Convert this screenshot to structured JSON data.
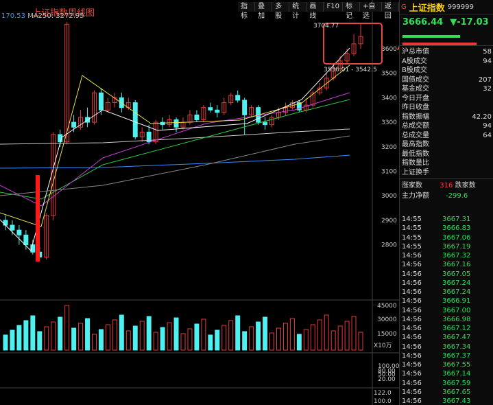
{
  "window": {
    "chart_title": "上证指数周线图"
  },
  "toolbar": {
    "buttons": [
      "指标",
      "叠加",
      "多股",
      "统计",
      "画线",
      "F10",
      "标记",
      "+自选",
      "返回"
    ]
  },
  "ma_legend": {
    "left_value": "170.53",
    "ma250_label": "MA250: 3272.95"
  },
  "chart_data": {
    "type": "candlestick",
    "price_axis_ticks": [
      "3600",
      "3500",
      "3400",
      "3300",
      "3200",
      "3100",
      "3000",
      "2900",
      "2800"
    ],
    "volume_axis_ticks": [
      "45000",
      "30000",
      "15000"
    ],
    "volume_unit": "X10万",
    "indicator_axis_ticks": [
      "100.00",
      "80.00",
      "50.00",
      "20.00"
    ],
    "bottom_axis_ticks": [
      "122.0",
      "100.0"
    ],
    "annotations": {
      "high_label": "3704.77",
      "range_label": "3536.01 - 3542.5"
    }
  },
  "quote": {
    "prefix": "G",
    "name": "上证指数",
    "code": "999999",
    "price": "3666.44",
    "change": "▼-17.03"
  },
  "info_rows": [
    {
      "label": "沪总市值",
      "value": "58"
    },
    {
      "label": "A股成交",
      "value": "94"
    },
    {
      "label": "B股成交",
      "value": ""
    },
    {
      "label": "国债成交",
      "value": "207"
    },
    {
      "label": "基金成交",
      "value": "32"
    },
    {
      "label": "今日开盘",
      "value": ""
    },
    {
      "label": "昨日收盘",
      "value": ""
    },
    {
      "label": "指数振幅",
      "value": "42.20"
    },
    {
      "label": "总成交额",
      "value": "94"
    },
    {
      "label": "总成交量",
      "value": "64"
    },
    {
      "label": "最高指数",
      "value": ""
    },
    {
      "label": "最低指数",
      "value": ""
    },
    {
      "label": "指数量比",
      "value": ""
    },
    {
      "label": "上证换手",
      "value": ""
    }
  ],
  "updown": {
    "up_label": "涨家数",
    "up_value": "316",
    "down_label": "跌家数"
  },
  "main_flow": {
    "label": "主力净额",
    "value": "-299.6"
  },
  "ticks": [
    {
      "time": "14:55",
      "price": "3667.31"
    },
    {
      "time": "14:55",
      "price": "3666.83"
    },
    {
      "time": "14:55",
      "price": "3667.06"
    },
    {
      "time": "14:55",
      "price": "3667.19"
    },
    {
      "time": "14:56",
      "price": "3667.32"
    },
    {
      "time": "14:56",
      "price": "3667.16"
    },
    {
      "time": "14:56",
      "price": "3667.05"
    },
    {
      "time": "14:56",
      "price": "3667.24"
    },
    {
      "time": "14:56",
      "price": "3667.24"
    },
    {
      "time": "14:56",
      "price": "3666.91"
    },
    {
      "time": "14:56",
      "price": "3667.00"
    },
    {
      "time": "14:56",
      "price": "3666.98"
    },
    {
      "time": "14:56",
      "price": "3667.12"
    },
    {
      "time": "14:56",
      "price": "3667.47"
    },
    {
      "time": "14:56",
      "price": "3667.34"
    },
    {
      "time": "14:56",
      "price": "3667.37"
    },
    {
      "time": "14:56",
      "price": "3667.55"
    },
    {
      "time": "14:56",
      "price": "3667.14"
    },
    {
      "time": "14:56",
      "price": "3667.59"
    },
    {
      "time": "14:56",
      "price": "3667.65"
    },
    {
      "time": "14:56",
      "price": "3667.43"
    }
  ],
  "colors": {
    "up": "#e63a3a",
    "down": "#4ff0f0",
    "ma5": "#ffffff",
    "ma10": "#e8e04a",
    "ma20": "#c040d0",
    "ma30": "#2ecc40",
    "ma60": "#cccccc",
    "ma120": "#3a8cff"
  }
}
